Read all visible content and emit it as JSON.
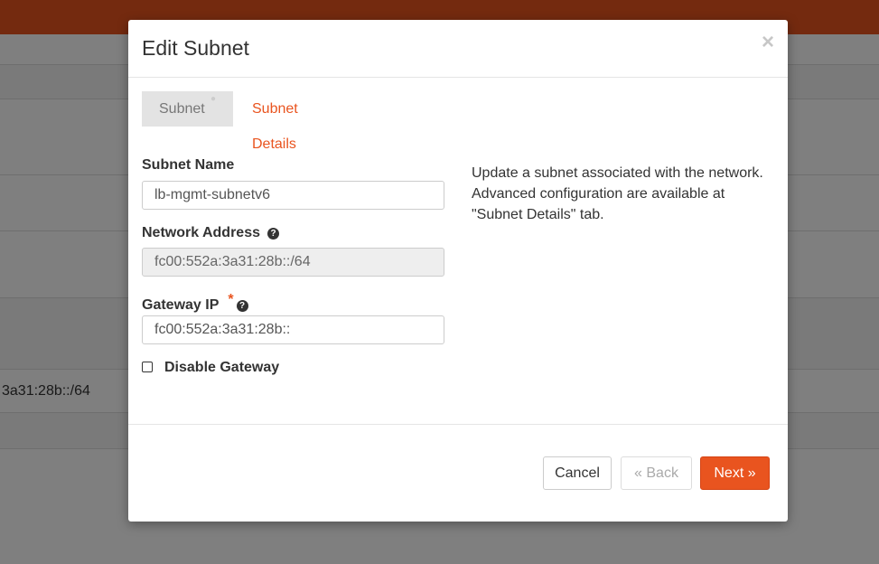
{
  "background": {
    "table_cell_left": "3a31:28b::/64",
    "table_cell_right": ":"
  },
  "modal": {
    "title": "Edit Subnet",
    "close_label": "×",
    "tabs": [
      {
        "label": "Subnet",
        "indicator": "●",
        "active": true
      },
      {
        "label": "Subnet Details",
        "active": false
      }
    ],
    "fields": {
      "subnet_name": {
        "label": "Subnet Name",
        "value": "lb-mgmt-subnetv6"
      },
      "network_address": {
        "label": "Network Address",
        "value": "fc00:552a:3a31:28b::/64",
        "help_icon": "?"
      },
      "gateway_ip": {
        "label": "Gateway IP",
        "required_mark": "*",
        "help_icon": "?",
        "value": "fc00:552a:3a31:28b::"
      },
      "disable_gateway": {
        "label": "Disable Gateway",
        "checked": false
      }
    },
    "help_text": "Update a subnet associated with the network. Advanced configuration are available at \"Subnet Details\" tab.",
    "buttons": {
      "cancel": "Cancel",
      "back": "«  Back",
      "next": "Next  »"
    }
  },
  "colors": {
    "accent": "#e9541f",
    "overlay": "rgba(0,0,0,0.5)"
  }
}
